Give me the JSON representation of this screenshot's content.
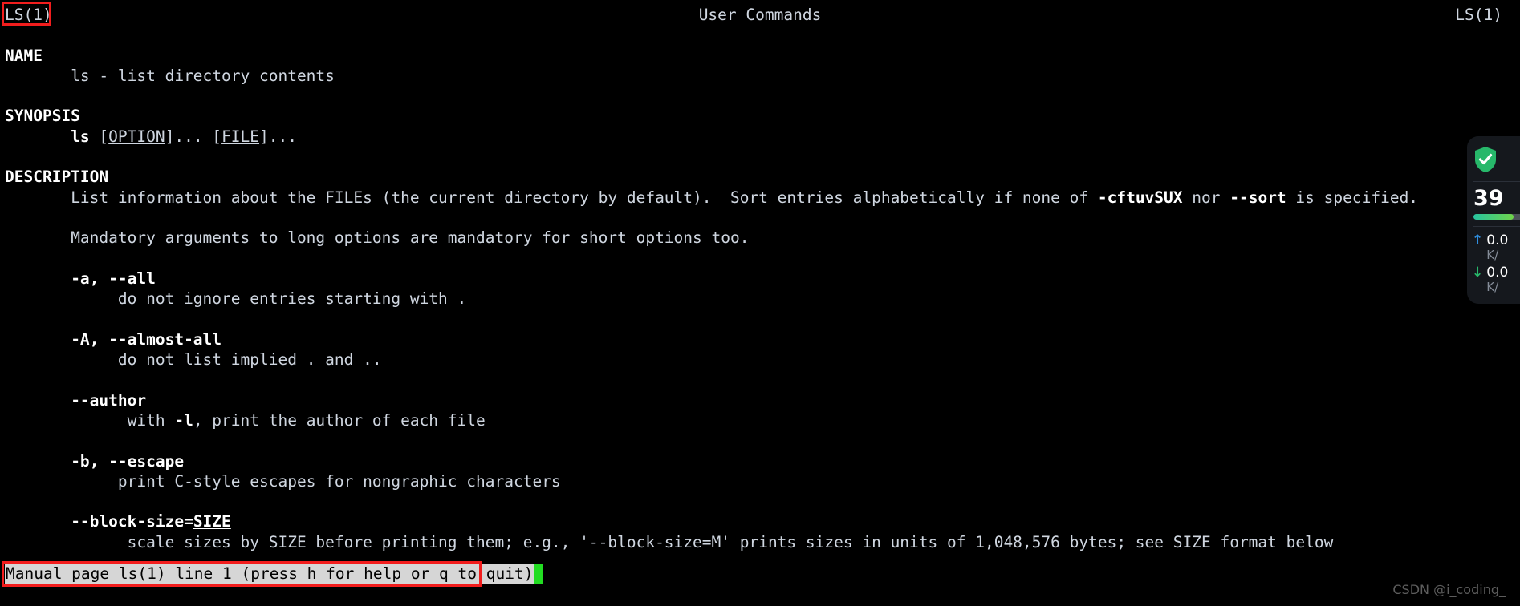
{
  "window": {
    "background_color": "#000000",
    "foreground_color": "#d8dee9"
  },
  "man_page": {
    "header": {
      "left": "LS(1)",
      "center": "User Commands",
      "right": "LS(1)"
    },
    "sections": [
      {
        "heading": "NAME"
      },
      {
        "heading": "SYNOPSIS"
      },
      {
        "heading": "DESCRIPTION"
      }
    ],
    "name_body": "ls - list directory contents",
    "synopsis": {
      "command": "ls",
      "option_open": " [",
      "option_arg": "OPTION",
      "option_close": "]... [",
      "file_arg": "FILE",
      "file_close": "]..."
    },
    "description": {
      "para1_a": "List information about the FILEs (the current directory by default).  Sort entries alphabetically if none of ",
      "para1_flags": "-cftuvSUX",
      "para1_b": " nor ",
      "para1_sort": "--sort",
      "para1_c": " is specified.",
      "para2": "Mandatory arguments to long options are mandatory for short options too."
    },
    "options": [
      {
        "flag": "-a, --all",
        "description": "do not ignore entries starting with ."
      },
      {
        "flag": "-A, --almost-all",
        "description": "do not list implied . and .."
      },
      {
        "flag": "--author",
        "desc_prefix": "with ",
        "desc_flag": "-l",
        "desc_suffix": ", print the author of each file"
      },
      {
        "flag": "-b, --escape",
        "description": "print C-style escapes for nongraphic characters"
      },
      {
        "flag": "--block-size=",
        "flag_arg": "SIZE",
        "description": "scale sizes by SIZE before printing them; e.g., '--block-size=M' prints sizes in units of 1,048,576 bytes; see SIZE format below"
      }
    ]
  },
  "status_bar": {
    "text": "Manual page ls(1) line 1 (press h for help or q to quit)",
    "cursor": "block-cursor",
    "cursor_color": "#22dd22",
    "background_color": "#d6d6d6",
    "text_color": "#000000"
  },
  "annotations": [
    {
      "name": "title-highlight",
      "color": "#f21d1d",
      "target": "LS(1)"
    },
    {
      "name": "status-highlight",
      "color": "#f21d1d",
      "target": "Manual page ls(1) line 1 (press h for help or q to quit)"
    }
  ],
  "monitor_widget": {
    "shield_icon": "shield-check-icon",
    "shield_color": "#27b86a",
    "score": "39",
    "score_bar_percent": 62,
    "upload": {
      "icon": "arrow-up-icon",
      "value": "0.0",
      "unit": "K/",
      "color": "#2f8fe0"
    },
    "download": {
      "icon": "arrow-down-icon",
      "value": "0.0",
      "unit": "K/",
      "color": "#27b86a"
    }
  },
  "watermark": {
    "text": "CSDN @i_coding_"
  }
}
